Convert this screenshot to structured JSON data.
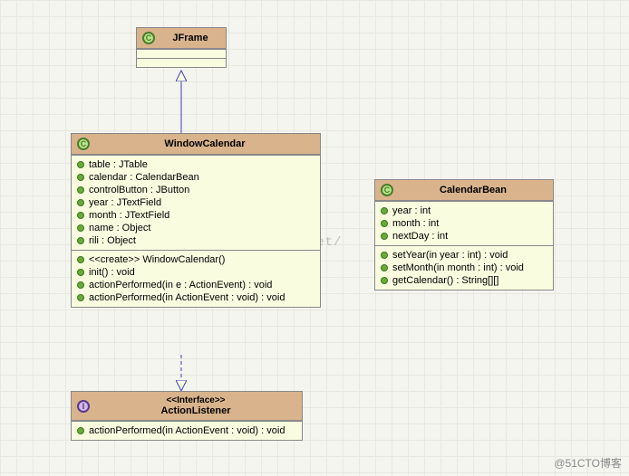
{
  "classes": {
    "jframe": {
      "name": "JFrame",
      "icon": "C",
      "attributes": [],
      "operations": []
    },
    "windowcalendar": {
      "name": "WindowCalendar",
      "icon": "C",
      "attributes": [
        "table : JTable",
        "calendar : CalendarBean",
        "controlButton : JButton",
        "year : JTextField",
        "month : JTextField",
        "name : Object",
        "rili : Object"
      ],
      "operations": [
        "<<create>> WindowCalendar()",
        "init() : void",
        "actionPerformed(in e : ActionEvent) : void",
        "actionPerformed(in ActionEvent : void) : void"
      ]
    },
    "calendarbean": {
      "name": "CalendarBean",
      "icon": "C",
      "attributes": [
        "year : int",
        "month : int",
        "nextDay : int"
      ],
      "operations": [
        "setYear(in year : int) : void",
        "setMonth(in month : int) : void",
        "getCalendar() : String[][]"
      ]
    },
    "actionlistener": {
      "name": "ActionListener",
      "stereotype": "<<Interface>>",
      "icon": "I",
      "attributes": [],
      "operations": [
        "actionPerformed(in ActionEvent : void) : void"
      ]
    }
  },
  "relationships": [
    {
      "from": "WindowCalendar",
      "to": "JFrame",
      "type": "generalization"
    },
    {
      "from": "WindowCalendar",
      "to": "ActionListener",
      "type": "realization"
    }
  ],
  "watermark": "http://blog.csdn.net/",
  "footer": "@51CTO博客"
}
